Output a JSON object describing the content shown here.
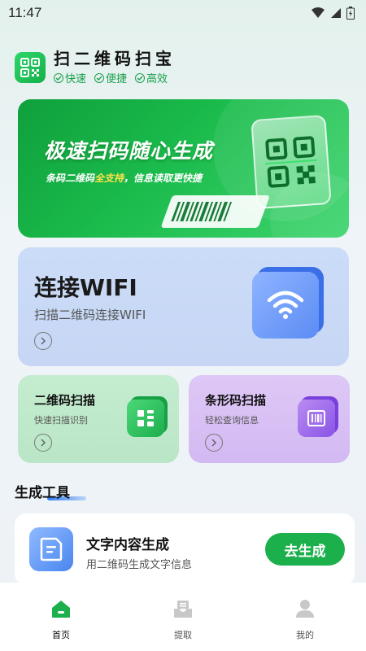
{
  "status_bar": {
    "time": "11:47"
  },
  "app": {
    "title": "扫二维码扫宝",
    "tags": [
      "快速",
      "便捷",
      "高效"
    ]
  },
  "banner": {
    "title": "极速扫码随心生成",
    "subtitle_prefix": "条码二维码",
    "subtitle_highlight": "全支持",
    "subtitle_suffix": "，信息读取更快捷"
  },
  "wifi_card": {
    "title": "连接WIFI",
    "subtitle": "扫描二维码连接WIFI"
  },
  "qr_card": {
    "title": "二维码扫描",
    "subtitle": "快速扫描识别"
  },
  "barcode_card": {
    "title": "条形码扫描",
    "subtitle": "轻松查询信息"
  },
  "section": {
    "title": "生成工具"
  },
  "tool": {
    "title": "文字内容生成",
    "subtitle": "用二维码生成文字信息",
    "button_label": "去生成"
  },
  "nav": {
    "items": [
      {
        "label": "首页",
        "icon": "home-icon",
        "active": true
      },
      {
        "label": "提取",
        "icon": "inbox-icon",
        "active": false
      },
      {
        "label": "我的",
        "icon": "profile-icon",
        "active": false
      }
    ]
  },
  "colors": {
    "brand_green": "#1cb04c",
    "wifi_card": "#c6d6f4",
    "qr_card": "#b9e6c6",
    "barcode_card": "#d3b9f2",
    "underline_blue": "#2f7df6"
  }
}
